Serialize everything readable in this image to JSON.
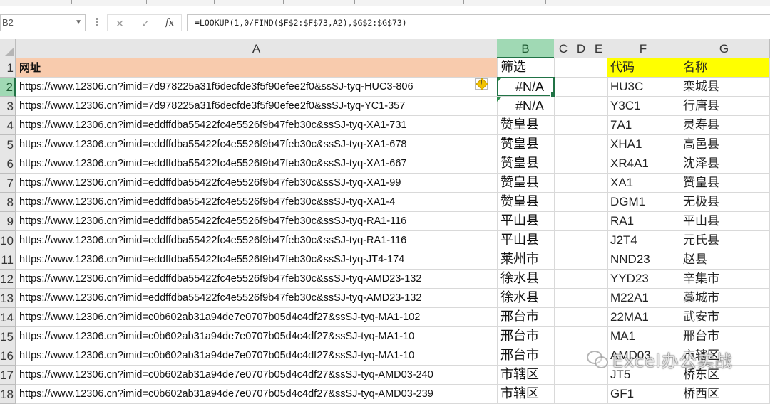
{
  "name_box": {
    "value": "B2"
  },
  "formula_bar": {
    "cancel_icon": "close-icon",
    "enter_icon": "check-icon",
    "fx_label": "fx",
    "formula": "=LOOKUP(1,0/FIND($F$2:$F$73,A2),$G$2:$G$73)"
  },
  "columns": [
    "A",
    "B",
    "C",
    "D",
    "E",
    "F",
    "G"
  ],
  "selected_column": "B",
  "selected_row": "2",
  "rows": [
    {
      "num": "1",
      "a": "网址",
      "b": "筛选",
      "f": "代码",
      "g": "名称"
    },
    {
      "num": "2",
      "a": "https://www.12306.cn?imid=7d978225a31f6decfde3f5f90efee2f0&ssSJ-tyq-HUC3-806",
      "b": "#N/A",
      "f": "HU3C",
      "g": "栾城县"
    },
    {
      "num": "3",
      "a": "https://www.12306.cn?imid=7d978225a31f6decfde3f5f90efee2f0&ssSJ-tyq-YC1-357",
      "b": "#N/A",
      "f": "Y3C1",
      "g": "行唐县"
    },
    {
      "num": "4",
      "a": "https://www.12306.cn?imid=eddffdba55422fc4e5526f9b47feb30c&ssSJ-tyq-XA1-731",
      "b": "赞皇县",
      "f": "7A1",
      "g": "灵寿县"
    },
    {
      "num": "5",
      "a": "https://www.12306.cn?imid=eddffdba55422fc4e5526f9b47feb30c&ssSJ-tyq-XA1-678",
      "b": "赞皇县",
      "f": "XHA1",
      "g": "高邑县"
    },
    {
      "num": "6",
      "a": "https://www.12306.cn?imid=eddffdba55422fc4e5526f9b47feb30c&ssSJ-tyq-XA1-667",
      "b": "赞皇县",
      "f": "XR4A1",
      "g": "沈泽县"
    },
    {
      "num": "7",
      "a": "https://www.12306.cn?imid=eddffdba55422fc4e5526f9b47feb30c&ssSJ-tyq-XA1-99",
      "b": "赞皇县",
      "f": "XA1",
      "g": "赞皇县"
    },
    {
      "num": "8",
      "a": "https://www.12306.cn?imid=eddffdba55422fc4e5526f9b47feb30c&ssSJ-tyq-XA1-4",
      "b": "赞皇县",
      "f": "DGM1",
      "g": "无极县"
    },
    {
      "num": "9",
      "a": "https://www.12306.cn?imid=eddffdba55422fc4e5526f9b47feb30c&ssSJ-tyq-RA1-116",
      "b": "平山县",
      "f": "RA1",
      "g": "平山县"
    },
    {
      "num": "10",
      "a": "https://www.12306.cn?imid=eddffdba55422fc4e5526f9b47feb30c&ssSJ-tyq-RA1-116",
      "b": "平山县",
      "f": "J2T4",
      "g": "元氏县"
    },
    {
      "num": "11",
      "a": "https://www.12306.cn?imid=eddffdba55422fc4e5526f9b47feb30c&ssSJ-tyq-JT4-174",
      "b": "莱州市",
      "f": "NND23",
      "g": "赵县"
    },
    {
      "num": "12",
      "a": "https://www.12306.cn?imid=eddffdba55422fc4e5526f9b47feb30c&ssSJ-tyq-AMD23-132",
      "b": "徐水县",
      "f": "YYD23",
      "g": "辛集市"
    },
    {
      "num": "13",
      "a": "https://www.12306.cn?imid=eddffdba55422fc4e5526f9b47feb30c&ssSJ-tyq-AMD23-132",
      "b": "徐水县",
      "f": "M22A1",
      "g": "藁城市"
    },
    {
      "num": "14",
      "a": "https://www.12306.cn?imid=c0b602ab31a94de7e0707b05d4c4df27&ssSJ-tyq-MA1-102",
      "b": "邢台市",
      "f": "22MA1",
      "g": "武安市"
    },
    {
      "num": "15",
      "a": "https://www.12306.cn?imid=c0b602ab31a94de7e0707b05d4c4df27&ssSJ-tyq-MA1-10",
      "b": "邢台市",
      "f": "MA1",
      "g": "邢台市"
    },
    {
      "num": "16",
      "a": "https://www.12306.cn?imid=c0b602ab31a94de7e0707b05d4c4df27&ssSJ-tyq-MA1-10",
      "b": "邢台市",
      "f": "AMD03",
      "g": "市辖区"
    },
    {
      "num": "17",
      "a": "https://www.12306.cn?imid=c0b602ab31a94de7e0707b05d4c4df27&ssSJ-tyq-AMD03-240",
      "b": "市辖区",
      "f": "JT5",
      "g": "桥东区"
    },
    {
      "num": "18",
      "a": "https://www.12306.cn?imid=c0b602ab31a94de7e0707b05d4c4df27&ssSJ-tyq-AMD03-239",
      "b": "市辖区",
      "f": "GF1",
      "g": "桥西区"
    }
  ],
  "error_indicator_icon": "warning-icon",
  "watermark": {
    "text": "Excel办公实战"
  },
  "colors": {
    "header_a_fill": "#f8cbad",
    "header_fg_fill": "#ffff00",
    "selection_green": "#217346",
    "selected_header_fill": "#a0d9b4"
  }
}
